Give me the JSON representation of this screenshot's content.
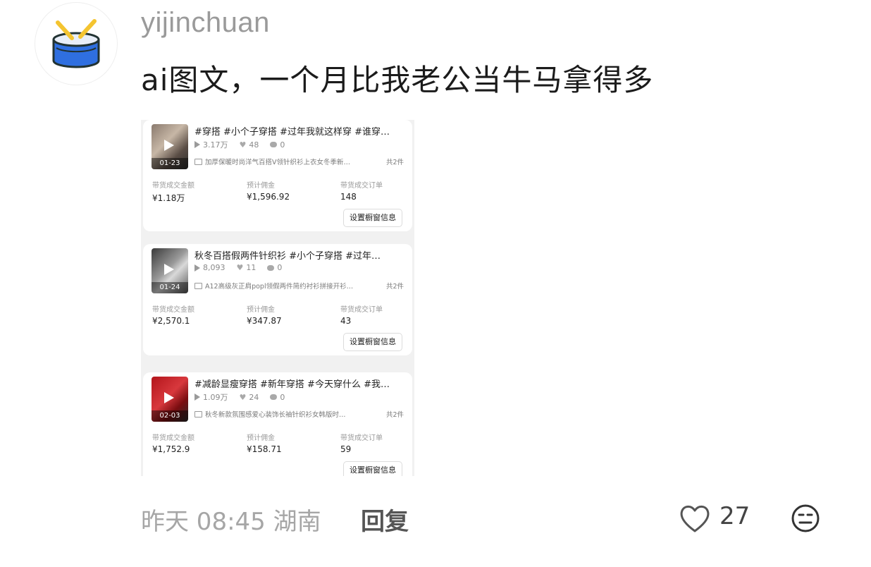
{
  "comment": {
    "username": "yijinchuan",
    "text": "ai图文，一个月比我老公当牛马拿得多",
    "time_location": "昨天 08:45 湖南",
    "reply_label": "回复",
    "like_count": "27"
  },
  "attachment": {
    "labels": {
      "gmv": "带货成交金额",
      "commission": "预计佣金",
      "orders": "带货成交订单",
      "button": "设置橱窗信息"
    },
    "cards": [
      {
        "date": "01-23",
        "title": "#穿搭 #小个子穿搭 #过年我就这样穿 #谁穿…",
        "plays": "3.17万",
        "likes": "48",
        "comments": "0",
        "product": "加厚保暖时尚洋气百搭V领针织衫上衣女冬季新…",
        "product_count": "共2件",
        "gmv": "¥1.18万",
        "commission": "¥1,596.92",
        "orders": "148"
      },
      {
        "date": "01-24",
        "title": "秋冬百搭假两件针织衫 #小个子穿搭 #过年…",
        "plays": "8,093",
        "likes": "11",
        "comments": "0",
        "product": "A12高级灰正肩popl领假两件简约衬衫拼接开衫…",
        "product_count": "共2件",
        "gmv": "¥2,570.1",
        "commission": "¥347.87",
        "orders": "43"
      },
      {
        "date": "02-03",
        "title": "#减龄显瘦穿搭 #新年穿搭 #今天穿什么 #我…",
        "plays": "1.09万",
        "likes": "24",
        "comments": "0",
        "product": "秋冬新款氛围感爱心装饰长袖针织衫女韩版时…",
        "product_count": "共2件",
        "gmv": "¥1,752.9",
        "commission": "¥158.71",
        "orders": "59"
      }
    ]
  },
  "icons": {
    "avatar": "drum-icon",
    "like": "heart-outline-icon",
    "emoji": "neutral-face-icon"
  },
  "colors": {
    "drum_blue": "#2f6fe0",
    "drum_yellow": "#f4c430",
    "thumb_red": "#c0272d"
  }
}
